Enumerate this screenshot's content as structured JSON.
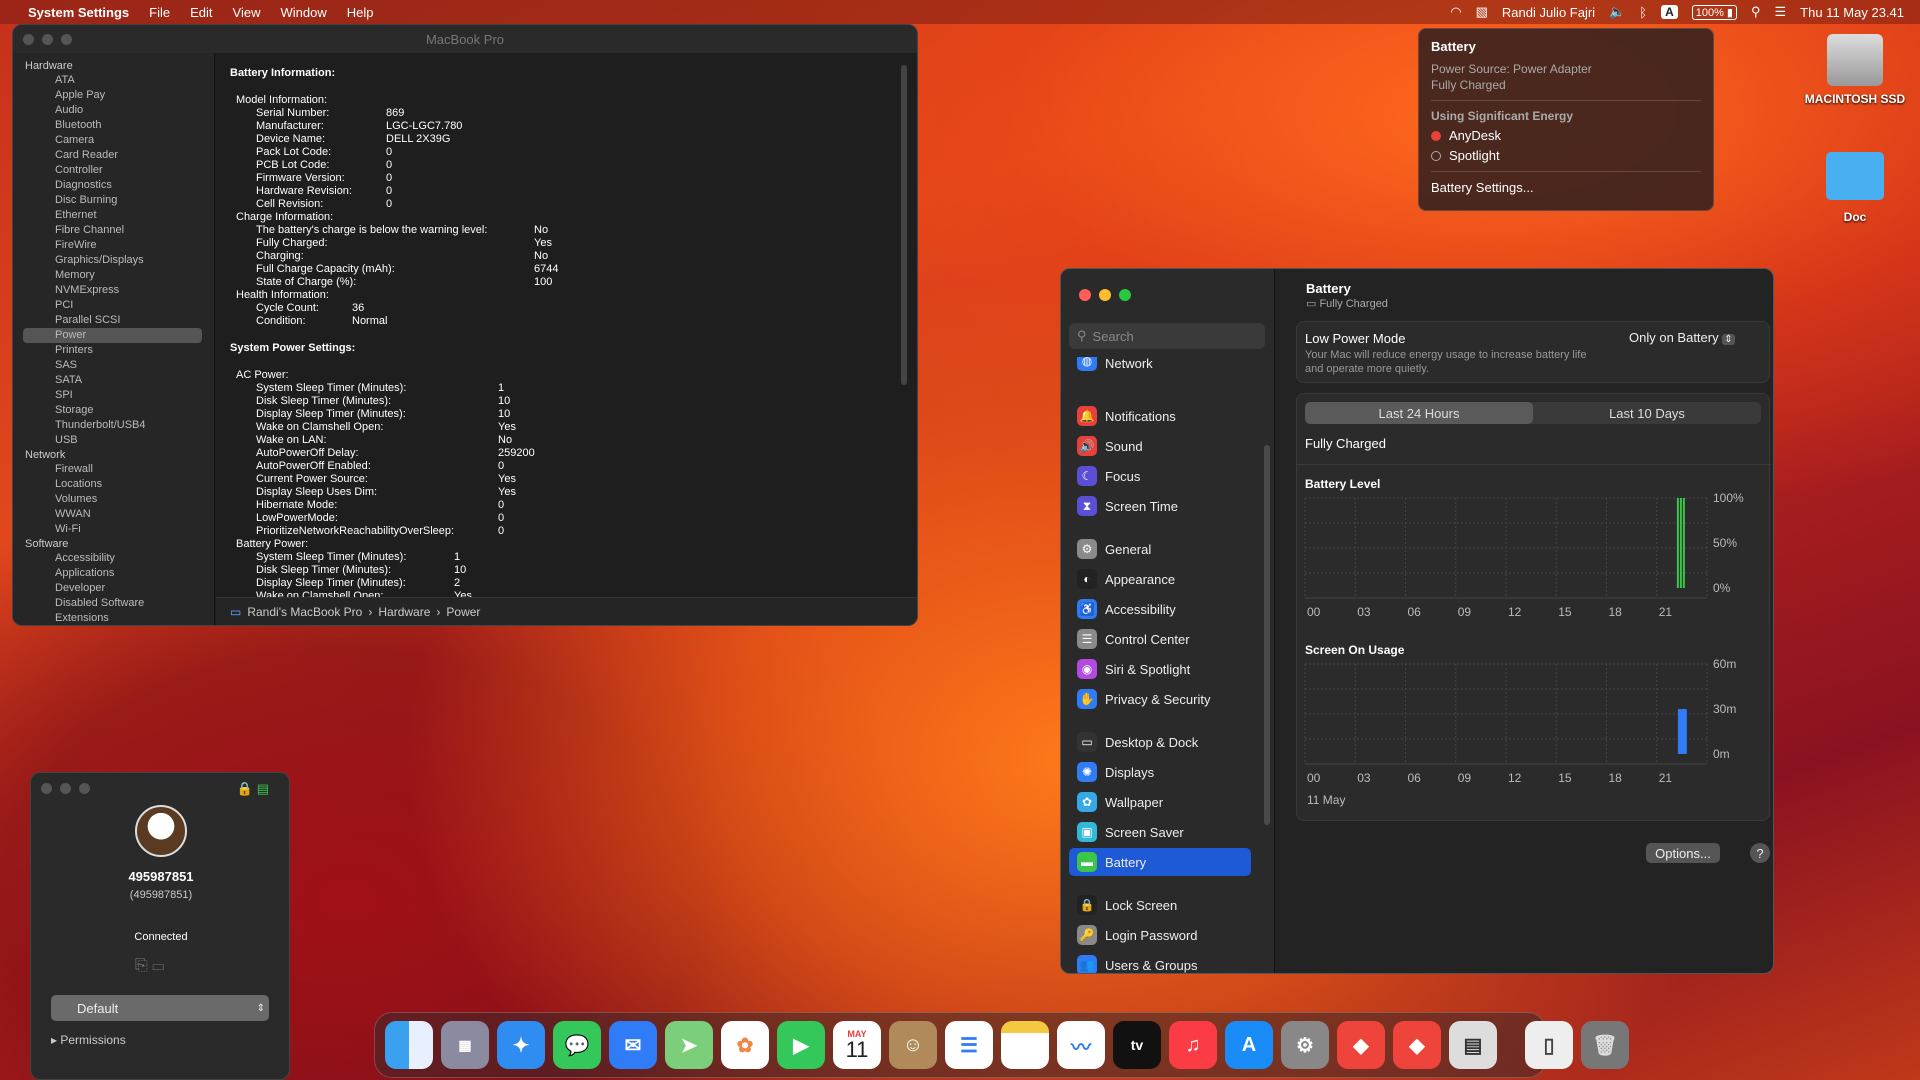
{
  "menubar": {
    "app": "System Settings",
    "menus": [
      "File",
      "Edit",
      "View",
      "Window",
      "Help"
    ],
    "user": "Randi Julio Fajri",
    "battery": "100%",
    "keyboard": "A",
    "datetime": "Thu 11 May 23.41"
  },
  "battery_popup": {
    "title": "Battery",
    "source": "Power Source: Power Adapter",
    "state": "Fully Charged",
    "section": "Using Significant Energy",
    "apps": [
      "AnyDesk",
      "Spotlight"
    ],
    "settings": "Battery Settings..."
  },
  "desktop": {
    "disk": "MACINTOSH SSD",
    "folder": "Doc"
  },
  "sysinfo": {
    "title": "MacBook Pro",
    "sidebar": [
      {
        "g": "Hardware",
        "items": [
          "ATA",
          "Apple Pay",
          "Audio",
          "Bluetooth",
          "Camera",
          "Card Reader",
          "Controller",
          "Diagnostics",
          "Disc Burning",
          "Ethernet",
          "Fibre Channel",
          "FireWire",
          "Graphics/Displays",
          "Memory",
          "NVMExpress",
          "PCI",
          "Parallel SCSI",
          "Power",
          "Printers",
          "SAS",
          "SATA",
          "SPI",
          "Storage",
          "Thunderbolt/USB4",
          "USB"
        ]
      },
      {
        "g": "Network",
        "items": [
          "Firewall",
          "Locations",
          "Volumes",
          "WWAN",
          "Wi-Fi"
        ]
      },
      {
        "g": "Software",
        "items": [
          "Accessibility",
          "Applications",
          "Developer",
          "Disabled Software",
          "Extensions"
        ]
      }
    ],
    "selected": "Power",
    "h_battery": "Battery Information:",
    "model_h": "Model Information:",
    "model": [
      [
        "Serial Number:",
        "869"
      ],
      [
        "Manufacturer:",
        "LGC-LGC7.780"
      ],
      [
        "Device Name:",
        "DELL 2X39G"
      ],
      [
        "Pack Lot Code:",
        "0"
      ],
      [
        "PCB Lot Code:",
        "0"
      ],
      [
        "Firmware Version:",
        "0"
      ],
      [
        "Hardware Revision:",
        "0"
      ],
      [
        "Cell Revision:",
        "0"
      ]
    ],
    "charge_h": "Charge Information:",
    "charge": [
      [
        "The battery's charge is below the warning level:",
        "No"
      ],
      [
        "Fully Charged:",
        "Yes"
      ],
      [
        "Charging:",
        "No"
      ],
      [
        "Full Charge Capacity (mAh):",
        "6744"
      ],
      [
        "State of Charge (%):",
        "100"
      ]
    ],
    "health_h": "Health Information:",
    "health": [
      [
        "Cycle Count:",
        "36"
      ],
      [
        "Condition:",
        "Normal"
      ]
    ],
    "h_power": "System Power Settings:",
    "ac_h": "AC Power:",
    "ac": [
      [
        "System Sleep Timer (Minutes):",
        "1"
      ],
      [
        "Disk Sleep Timer (Minutes):",
        "10"
      ],
      [
        "Display Sleep Timer (Minutes):",
        "10"
      ],
      [
        "Wake on Clamshell Open:",
        "Yes"
      ],
      [
        "Wake on LAN:",
        "No"
      ],
      [
        "AutoPowerOff Delay:",
        "259200"
      ],
      [
        "AutoPowerOff Enabled:",
        "0"
      ],
      [
        "Current Power Source:",
        "Yes"
      ],
      [
        "Display Sleep Uses Dim:",
        "Yes"
      ],
      [
        "Hibernate Mode:",
        "0"
      ],
      [
        "LowPowerMode:",
        "0"
      ],
      [
        "PrioritizeNetworkReachabilityOverSleep:",
        "0"
      ]
    ],
    "bp_h": "Battery Power:",
    "bp": [
      [
        "System Sleep Timer (Minutes):",
        "1"
      ],
      [
        "Disk Sleep Timer (Minutes):",
        "10"
      ],
      [
        "Display Sleep Timer (Minutes):",
        "2"
      ],
      [
        "Wake on Clamshell Open:",
        "Yes"
      ]
    ],
    "path": [
      "Randi's MacBook Pro",
      "Hardware",
      "Power"
    ]
  },
  "settings": {
    "search": "Search",
    "items": [
      {
        "label": "Network",
        "color": "#2f7cf6",
        "icon": "◍"
      },
      {
        "label": "Notifications",
        "color": "#e8413b",
        "icon": "🔔"
      },
      {
        "label": "Sound",
        "color": "#e8413b",
        "icon": "🔊"
      },
      {
        "label": "Focus",
        "color": "#5b4fd6",
        "icon": "☾"
      },
      {
        "label": "Screen Time",
        "color": "#5b4fd6",
        "icon": "⧗"
      },
      {
        "label": "General",
        "color": "#8a8a8a",
        "icon": "⚙"
      },
      {
        "label": "Appearance",
        "color": "#222222",
        "icon": "◐"
      },
      {
        "label": "Accessibility",
        "color": "#2f7cf6",
        "icon": "♿"
      },
      {
        "label": "Control Center",
        "color": "#8a8a8a",
        "icon": "☰"
      },
      {
        "label": "Siri & Spotlight",
        "color": "#b34be0",
        "icon": "◉"
      },
      {
        "label": "Privacy & Security",
        "color": "#2f7cf6",
        "icon": "✋"
      },
      {
        "label": "Desktop & Dock",
        "color": "#333333",
        "icon": "▭"
      },
      {
        "label": "Displays",
        "color": "#2f7cf6",
        "icon": "✺"
      },
      {
        "label": "Wallpaper",
        "color": "#35a8e8",
        "icon": "✿"
      },
      {
        "label": "Screen Saver",
        "color": "#35b8d8",
        "icon": "▣"
      },
      {
        "label": "Battery",
        "color": "#3bc54a",
        "icon": "▬"
      },
      {
        "label": "Lock Screen",
        "color": "#222222",
        "icon": "🔒"
      },
      {
        "label": "Login Password",
        "color": "#8a8a8a",
        "icon": "🔑"
      },
      {
        "label": "Users & Groups",
        "color": "#2f7cf6",
        "icon": "👥"
      }
    ],
    "selected": "Battery",
    "header": {
      "title": "Battery",
      "sub": "Fully Charged"
    },
    "lpm": {
      "label": "Low Power Mode",
      "desc": "Your Mac will reduce energy usage to increase battery life and operate more quietly.",
      "value": "Only on Battery"
    },
    "tabs": [
      "Last 24 Hours",
      "Last 10 Days"
    ],
    "status": "Fully Charged",
    "options": "Options...",
    "help": "?"
  },
  "chart_data": [
    {
      "type": "bar",
      "title": "Battery Level",
      "x": [
        "00",
        "03",
        "06",
        "09",
        "12",
        "15",
        "18",
        "21"
      ],
      "yticks": [
        "100%",
        "50%",
        "0%"
      ],
      "ylim": [
        0,
        100
      ],
      "values": [
        {
          "hour": 22.5,
          "value": 100
        }
      ],
      "color": "#3bc54a"
    },
    {
      "type": "bar",
      "title": "Screen On Usage",
      "x": [
        "00",
        "03",
        "06",
        "09",
        "12",
        "15",
        "18",
        "21"
      ],
      "yticks": [
        "60m",
        "30m",
        "0m"
      ],
      "ylim": [
        0,
        60
      ],
      "date_label": "11 May",
      "values": [
        {
          "hour": 22.5,
          "value": 30
        }
      ],
      "color": "#2f7cf6"
    }
  ],
  "anydesk": {
    "id": "495987851",
    "alias": "(495987851)",
    "status": "Connected",
    "profile": "Default",
    "permissions": "Permissions"
  },
  "dock": {
    "calendar_month": "MAY",
    "calendar_day": "11",
    "tv": "tv"
  }
}
